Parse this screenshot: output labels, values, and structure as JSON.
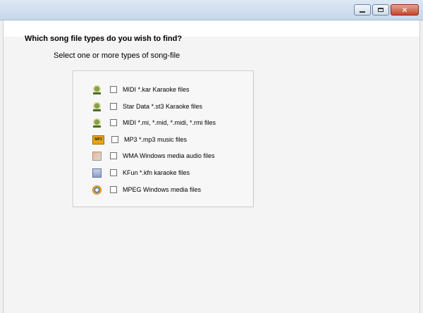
{
  "window": {
    "title": "",
    "buttons": {
      "minimize": "minimize",
      "maximize": "maximize",
      "close": "✕"
    }
  },
  "page": {
    "heading": "Which song file types do you wish to find?",
    "subheading": "Select one or more types of song-file"
  },
  "file_types": [
    {
      "icon": "karaoke-file-icon",
      "label": "MIDI *.kar Karaoke files",
      "checked": false
    },
    {
      "icon": "karaoke-file-icon",
      "label": "Star Data *.st3 Karaoke files",
      "checked": false
    },
    {
      "icon": "karaoke-file-icon",
      "label": "MIDI *.mi, *.mid, *.midi, *.rmi files",
      "checked": false
    },
    {
      "icon": "mp3-file-icon",
      "label": "MP3 *.mp3 music files",
      "checked": false
    },
    {
      "icon": "wma-file-icon",
      "label": "WMA Windows media audio files",
      "checked": false
    },
    {
      "icon": "kfn-file-icon",
      "label": "KFun *.kfn karaoke files",
      "checked": false
    },
    {
      "icon": "mpeg-file-icon",
      "label": "MPEG  Windows media  files",
      "checked": false
    }
  ]
}
